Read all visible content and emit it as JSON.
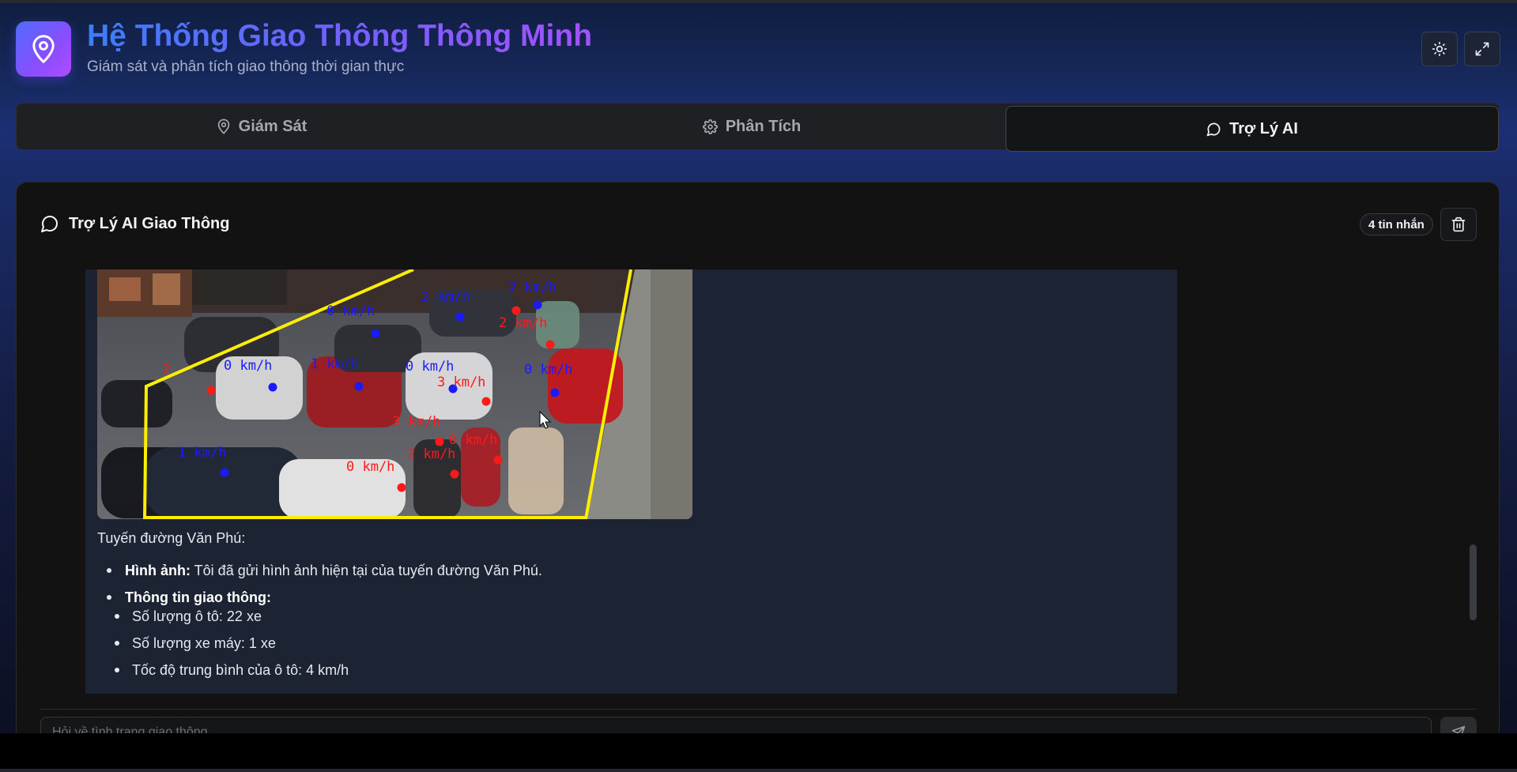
{
  "header": {
    "title": "Hệ Thống Giao Thông Thông Minh",
    "subtitle": "Giám sát và phân tích giao thông thời gian thực",
    "logo_icon": "map-pin-icon",
    "theme_icon": "sun-icon",
    "fullscreen_icon": "expand-icon"
  },
  "tabs": [
    {
      "label": "Giám Sát",
      "icon": "map-pin-icon",
      "active": false
    },
    {
      "label": "Phân Tích",
      "icon": "gear-icon",
      "active": false
    },
    {
      "label": "Trợ Lý AI",
      "icon": "chat-bubble-icon",
      "active": true
    }
  ],
  "chat": {
    "title": "Trợ Lý AI Giao Thông",
    "message_count": "4 tin nhắn",
    "input_placeholder": "Hỏi về tình trạng giao thông..."
  },
  "message": {
    "intro": "Tuyến đường Văn Phú:",
    "image_label_bold": "Hình ảnh:",
    "image_label_text": " Tôi đã gửi hình ảnh hiện tại của tuyến đường Văn Phú.",
    "traffic_label": "Thông tin giao thông:",
    "traffic_items": [
      "Số lượng ô tô: 22 xe",
      "Số lượng xe máy: 1 xe",
      "Tốc độ trung bình của ô tô: 4 km/h"
    ],
    "camera_overlays": {
      "blue": [
        "0 km/h",
        "2 km/h",
        "2 km/h",
        "0 km/h",
        "1 km/h",
        "0 km/h",
        "0 km/h",
        "1 km/h"
      ],
      "red": [
        "2 km/h",
        "2",
        "3 km/h",
        "3 km/h",
        "0 km/h",
        "2 km/h",
        "0 km/h"
      ]
    }
  },
  "colors": {
    "accent_start": "#3d7dff",
    "accent_end": "#a451ff",
    "zone_line": "#ffee00",
    "car_marker": "#1a1aff",
    "bike_marker": "#ff1a1a"
  }
}
